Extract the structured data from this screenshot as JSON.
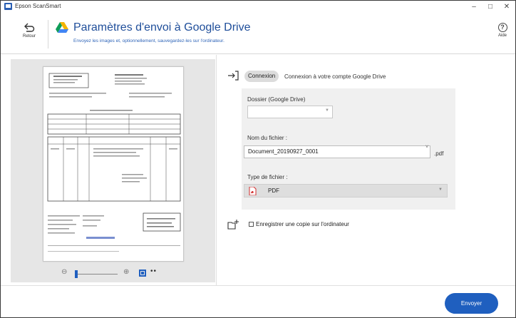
{
  "window": {
    "title": "Epson ScanSmart"
  },
  "header": {
    "back_label": "Retour",
    "title": "Paramètres d'envoi à Google Drive",
    "subtitle": "Envoyez les images et, optionnellement, sauvegardez-les sur l'ordinateur.",
    "help_label": "Aide"
  },
  "login": {
    "button_label": "Connexion",
    "description": "Connexion à votre compte Google Drive"
  },
  "settings": {
    "folder_label": "Dossier (Google Drive)",
    "folder_value": "",
    "filename_label": "Nom du fichier :",
    "filename_value": "Document_20190927_0001",
    "filename_extension": ".pdf",
    "filetype_label": "Type de fichier :",
    "filetype_value": "PDF"
  },
  "save_copy": {
    "label": "Enregistrer une copie sur l'ordinateur",
    "checked": false
  },
  "footer": {
    "send_label": "Envoyer"
  },
  "colors": {
    "accent": "#1f5fbf",
    "title": "#1f4e9a"
  }
}
